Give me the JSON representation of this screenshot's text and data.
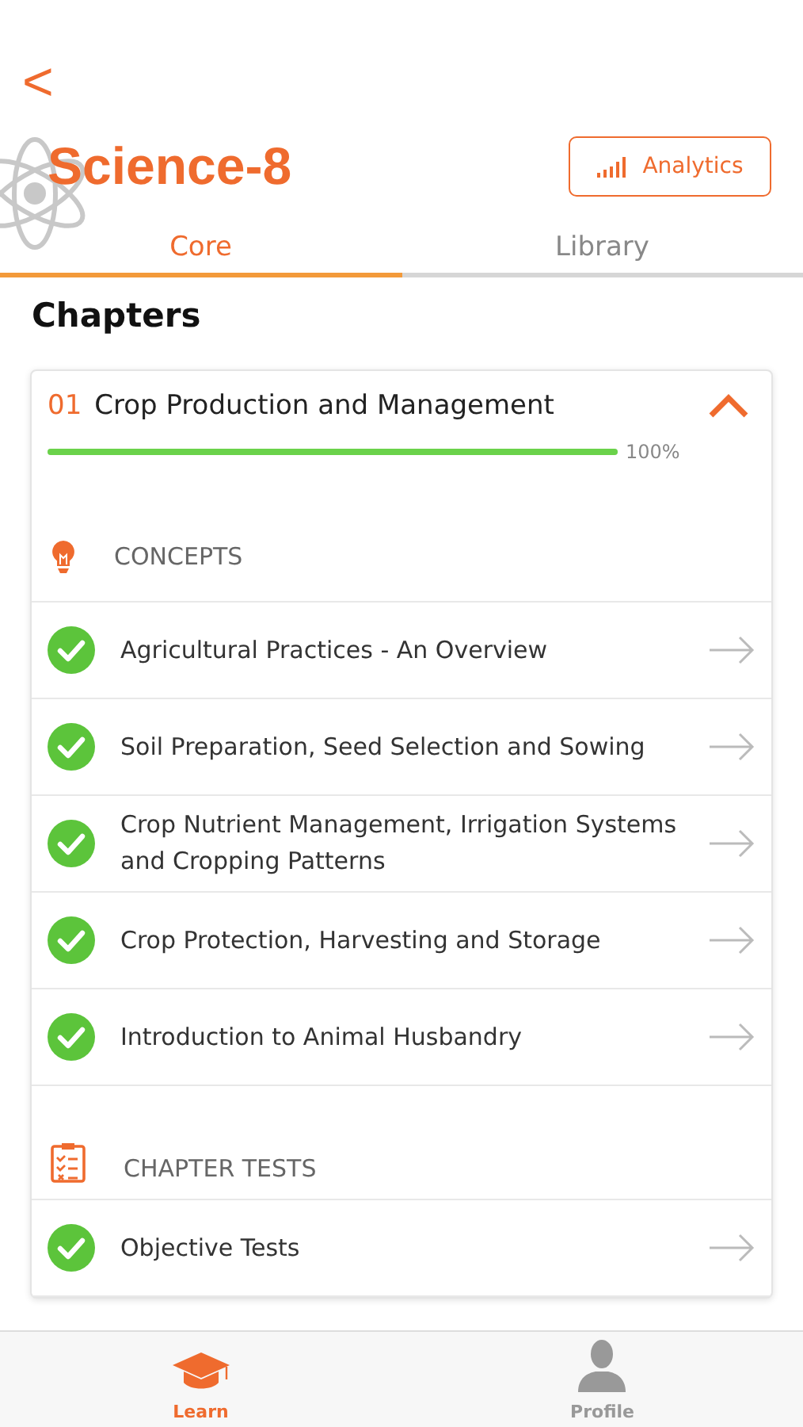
{
  "header": {
    "back": "<",
    "title": "Science-8",
    "analytics_button": "Analytics"
  },
  "tabs": [
    {
      "label": "Core",
      "selected": true
    },
    {
      "label": "Library",
      "selected": false
    }
  ],
  "section_title": "Chapters",
  "chapter": {
    "number": "01",
    "title": "Crop Production and Management",
    "expanded": true,
    "level": 1,
    "reading": "100%",
    "sections": [
      {
        "kind": "concepts",
        "heading": "CONCEPTS",
        "items": [
          {
            "label": "Agricultural Practices - An Overview",
            "done": true
          },
          {
            "label": "Soil Preparation, Seed Selection and Sowing",
            "done": true
          },
          {
            "label": "Crop Nutrient Management, Irrigation Systems and Cropping Patterns",
            "done": true
          },
          {
            "label": "Crop Protection, Harvesting and Storage",
            "done": true
          },
          {
            "label": "Introduction to Animal Husbandry",
            "done": true
          }
        ]
      },
      {
        "kind": "tests",
        "heading": "CHAPTER TESTS",
        "items": [
          {
            "label": "Objective Tests",
            "done": true
          }
        ]
      }
    ]
  },
  "bottom_nav": [
    {
      "kind": "learn",
      "label": "Learn",
      "selected": true
    },
    {
      "kind": "profile",
      "label": "Profile",
      "selected": false
    }
  ]
}
